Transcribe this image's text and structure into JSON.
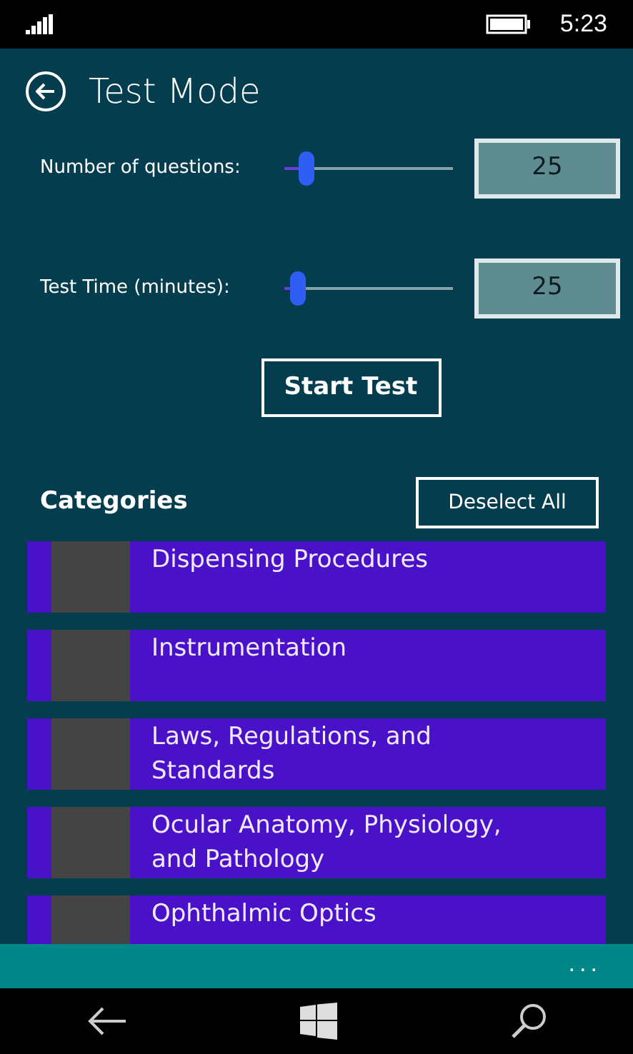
{
  "status_bar": {
    "time": "5:23"
  },
  "header": {
    "title": "Test Mode"
  },
  "settings": [
    {
      "label": "Number of questions:",
      "level": 0.13,
      "value": "25"
    },
    {
      "label": "Test Time (minutes):",
      "level": 0.08,
      "value": "25"
    }
  ],
  "start_button": "Start Test",
  "categories": {
    "title": "Categories",
    "deselect_button": "Deselect All",
    "items": [
      {
        "label": "Dispensing Procedures",
        "selected": true
      },
      {
        "label": "Instrumentation",
        "selected": true
      },
      {
        "label": "Laws, Regulations, and Standards",
        "selected": true
      },
      {
        "label": "Ocular Anatomy, Physiology, and Pathology",
        "selected": true
      },
      {
        "label": "Ophthalmic Optics",
        "selected": true
      }
    ]
  },
  "app_bar": {
    "more": "..."
  }
}
